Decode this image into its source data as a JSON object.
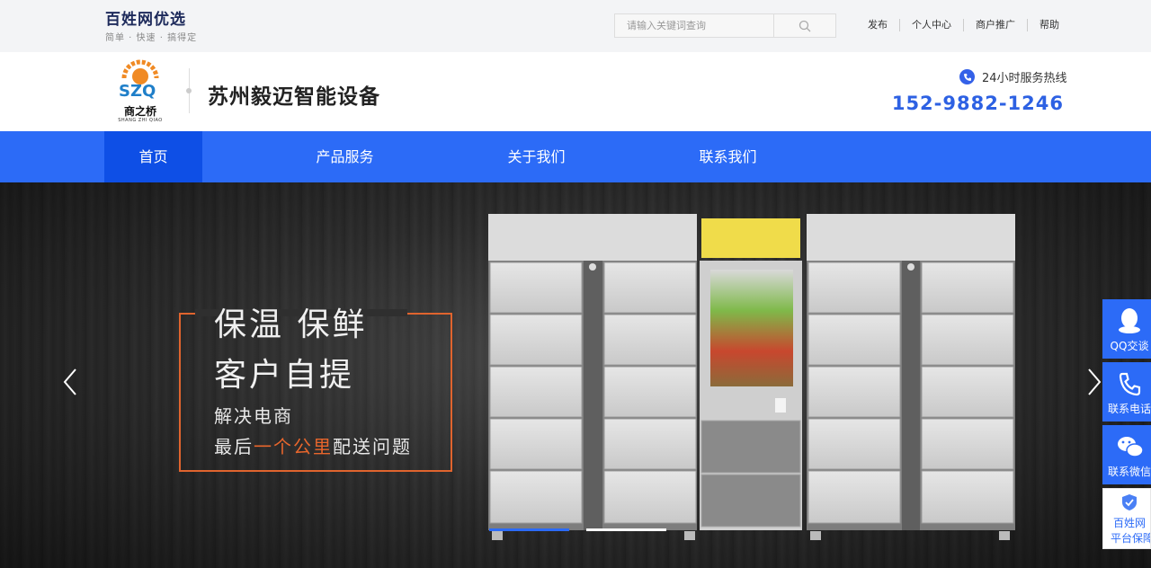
{
  "topbar": {
    "brand_name": "百姓网优选",
    "brand_slogan": "简单 · 快速 · 搞得定",
    "search_placeholder": "请输入关键词查询",
    "links": [
      "发布",
      "个人中心",
      "商户推广",
      "帮助"
    ]
  },
  "header": {
    "logo_cn": "商之桥",
    "logo_en": "SHANG ZHI QIAO",
    "company_name": "苏州毅迈智能设备",
    "hotline_label": "24小时服务热线",
    "hotline_number": "152-9882-1246"
  },
  "nav": {
    "items": [
      "首页",
      "产品服务",
      "关于我们",
      "联系我们"
    ],
    "active_index": 0
  },
  "banner": {
    "line1": "保温 保鲜",
    "line2": "客户自提",
    "line3": "解决电商",
    "line4_pre": "最后",
    "line4_highlight": "一个公里",
    "line4_post": "配送问题",
    "slide_count": 2,
    "active_slide": 1
  },
  "side_bar": {
    "items": [
      "QQ交谈",
      "联系电话",
      "联系微信"
    ],
    "guarantee_line1": "百姓网",
    "guarantee_line2": "平台保障"
  },
  "colors": {
    "primary": "#2c6bf7",
    "nav_active": "#0e4fe6",
    "hotline": "#2d61e3",
    "accent_orange": "#e0642e",
    "brand_dark": "#1d2a5b"
  },
  "icons": {
    "search": "search-icon",
    "phone": "phone-icon",
    "qq": "qq-icon",
    "wechat": "wechat-icon",
    "shield": "shield-icon",
    "prev": "chevron-left-icon",
    "next": "chevron-right-icon"
  }
}
